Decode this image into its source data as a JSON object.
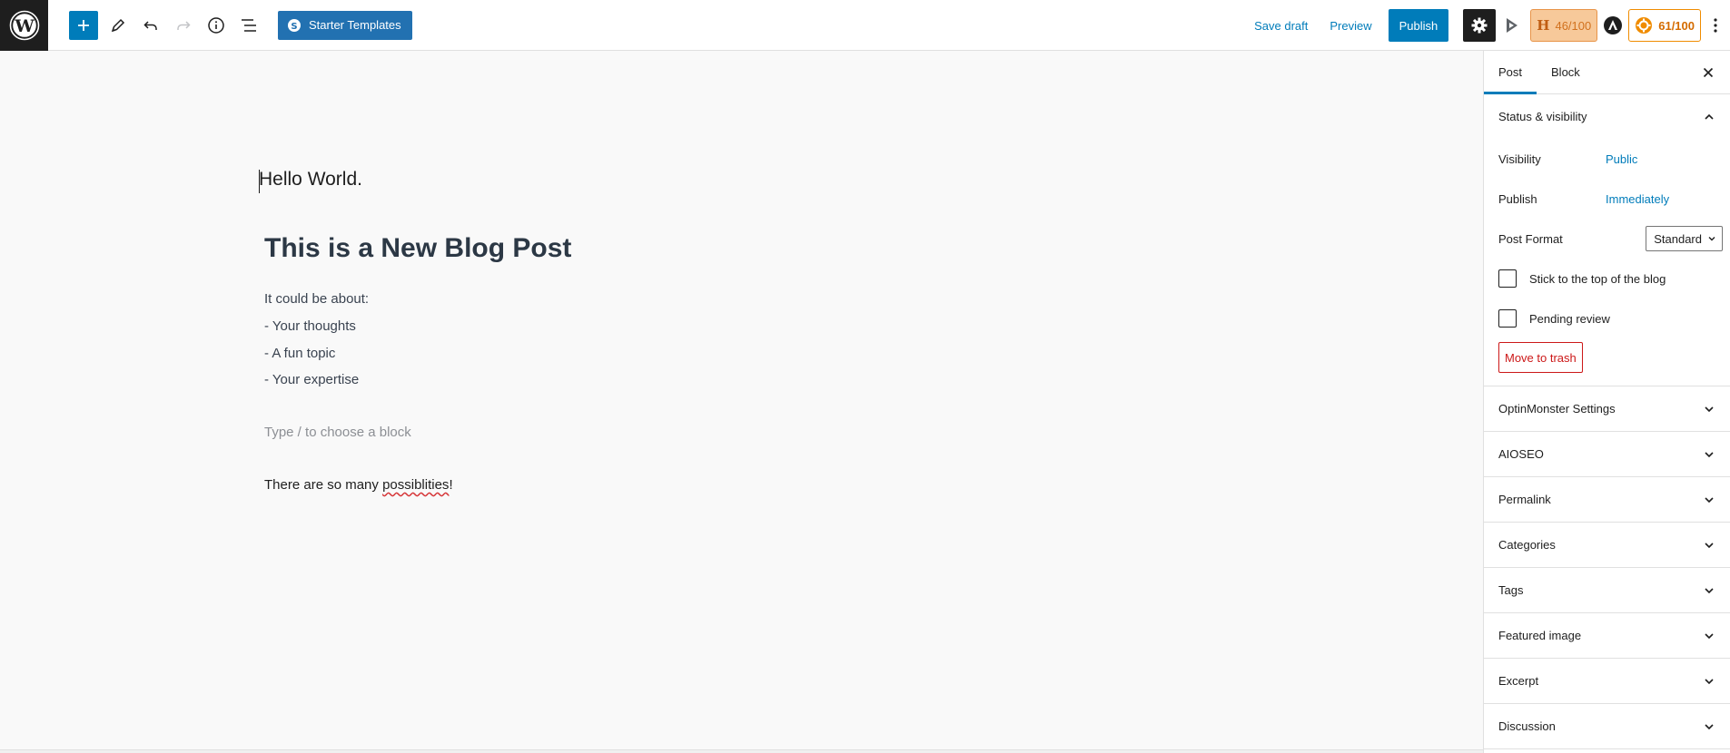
{
  "toolbar": {
    "starter_templates_label": "Starter Templates",
    "save_draft_label": "Save draft",
    "preview_label": "Preview",
    "publish_label": "Publish",
    "headline_score": "46/100",
    "headline_letter": "H",
    "seo_score": "61/100"
  },
  "editor": {
    "title": "Hello World.",
    "heading": "This is a New Blog Post",
    "lines": [
      "It could be about:",
      "- Your thoughts",
      "- A fun topic",
      "- Your expertise"
    ],
    "placeholder": "Type / to choose a block",
    "last_paragraph_before": "There are so many ",
    "last_paragraph_misspelled": "possiblities",
    "last_paragraph_after": "!"
  },
  "sidebar": {
    "tabs": [
      "Post",
      "Block"
    ],
    "status_panel": {
      "title": "Status & visibility",
      "visibility_label": "Visibility",
      "visibility_value": "Public",
      "publish_label": "Publish",
      "publish_value": "Immediately",
      "format_label": "Post Format",
      "format_value": "Standard",
      "sticky_label": "Stick to the top of the blog",
      "pending_label": "Pending review",
      "trash_label": "Move to trash"
    },
    "panels": [
      "OptinMonster Settings",
      "AIOSEO",
      "Permalink",
      "Categories",
      "Tags",
      "Featured image",
      "Excerpt",
      "Discussion"
    ]
  },
  "colors": {
    "accent": "#007cba",
    "danger": "#cc1818",
    "dark": "#1e1e1e"
  }
}
